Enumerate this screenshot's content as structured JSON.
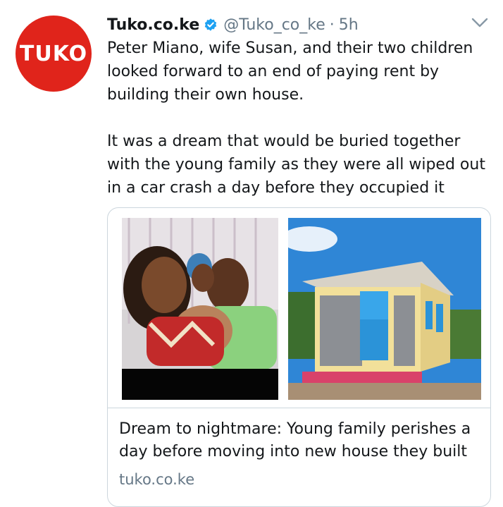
{
  "account": {
    "avatar_text": "TUKO",
    "name": "Tuko.co.ke",
    "handle": "@Tuko_co_ke",
    "separator": "·",
    "time": "5h"
  },
  "tweet": {
    "paragraph1": "Peter Miano, wife Susan, and their two children looked forward to an end of paying rent by building their own house.",
    "paragraph2": "It was a dream that would be buried together with the young family as they were all wiped out in a car crash a day before they occupied it"
  },
  "card": {
    "title": "Dream to nightmare: Young family perishes a day before moving into new house they built",
    "domain": "tuko.co.ke"
  },
  "colors": {
    "brand": "#e0241b",
    "verified": "#1da1f2",
    "secondary_text": "#657786"
  },
  "icons": {
    "verified": "verified-badge-icon",
    "menu": "chevron-down-icon"
  }
}
